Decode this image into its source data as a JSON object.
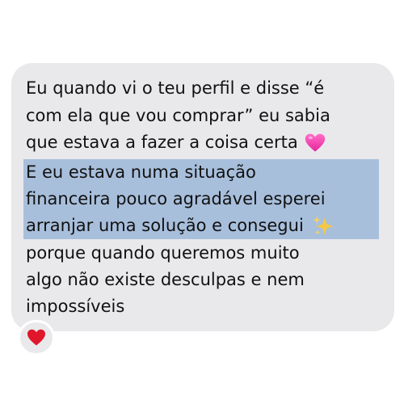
{
  "message": {
    "lines": [
      "Eu quando vi o teu perfil e disse “é",
      "com ela que vou comprar” eu sabia",
      "que estava a fazer a coisa certa",
      "E eu estava numa situação",
      "financeira pouco agradável esperei",
      "arranjar uma solução e consegui",
      "porque quando queremos muito",
      "algo não existe desculpas e nem",
      "impossíveis"
    ],
    "inline_emojis": [
      "pink-heart-icon",
      "sparkles-icon"
    ],
    "highlight_color": "#a8bfdc",
    "bubble_color": "#e9e9eb"
  },
  "reaction": {
    "icon": "red-heart-icon",
    "color": "#e0162b"
  }
}
